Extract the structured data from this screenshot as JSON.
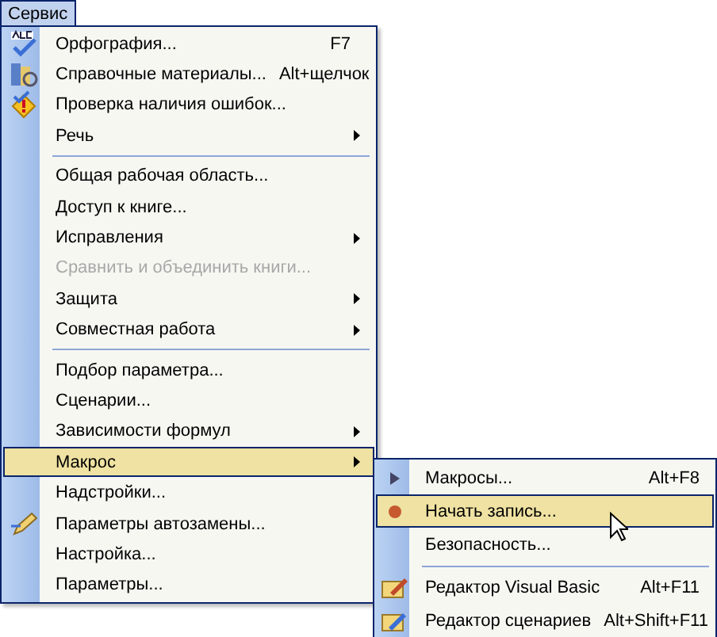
{
  "menu_bar": {
    "title": "Сервис",
    "selected": true
  },
  "menu": [
    {
      "kind": "item",
      "label": "Орфография...",
      "shortcut": "F7",
      "submenu": false,
      "disabled": false,
      "selected": false
    },
    {
      "kind": "item",
      "label": "Справочные материалы...",
      "shortcut": "Alt+щелчок",
      "submenu": false,
      "disabled": false,
      "selected": false
    },
    {
      "kind": "item",
      "label": "Проверка наличия ошибок...",
      "submenu": false,
      "disabled": false,
      "selected": false
    },
    {
      "kind": "item",
      "label": "Речь",
      "submenu": true,
      "disabled": false,
      "selected": false
    },
    {
      "kind": "separator"
    },
    {
      "kind": "item",
      "label": "Общая рабочая область...",
      "submenu": false,
      "disabled": false,
      "selected": false
    },
    {
      "kind": "item",
      "label": "Доступ к книге...",
      "submenu": false,
      "disabled": false,
      "selected": false
    },
    {
      "kind": "item",
      "label": "Исправления",
      "submenu": true,
      "disabled": false,
      "selected": false
    },
    {
      "kind": "item",
      "label": "Сравнить и объединить книги...",
      "submenu": false,
      "disabled": true,
      "selected": false
    },
    {
      "kind": "item",
      "label": "Защита",
      "submenu": true,
      "disabled": false,
      "selected": false
    },
    {
      "kind": "item",
      "label": "Совместная работа",
      "submenu": true,
      "disabled": false,
      "selected": false
    },
    {
      "kind": "separator"
    },
    {
      "kind": "item",
      "label": "Подбор параметра...",
      "submenu": false,
      "disabled": false,
      "selected": false
    },
    {
      "kind": "item",
      "label": "Сценарии...",
      "submenu": false,
      "disabled": false,
      "selected": false
    },
    {
      "kind": "item",
      "label": "Зависимости формул",
      "submenu": true,
      "disabled": false,
      "selected": false
    },
    {
      "kind": "item",
      "label": "Макрос",
      "submenu": true,
      "disabled": false,
      "selected": true
    },
    {
      "kind": "item",
      "label": "Надстройки...",
      "submenu": false,
      "disabled": false,
      "selected": false
    },
    {
      "kind": "item",
      "label": "Параметры автозамены...",
      "submenu": false,
      "disabled": false,
      "selected": false
    },
    {
      "kind": "item",
      "label": "Настройка...",
      "submenu": false,
      "disabled": false,
      "selected": false
    },
    {
      "kind": "item",
      "label": "Параметры...",
      "submenu": false,
      "disabled": false,
      "selected": false
    }
  ],
  "submenu": [
    {
      "kind": "item",
      "label": "Макросы...",
      "shortcut": "Alt+F8",
      "selected": false
    },
    {
      "kind": "item",
      "label": "Начать запись...",
      "selected": true
    },
    {
      "kind": "item",
      "label": "Безопасность...",
      "selected": false
    },
    {
      "kind": "separator"
    },
    {
      "kind": "item",
      "label": "Редактор Visual Basic",
      "shortcut": "Alt+F11",
      "selected": false
    },
    {
      "kind": "item",
      "label": "Редактор сценариев",
      "shortcut": "Alt+Shift+F11",
      "selected": false
    }
  ]
}
